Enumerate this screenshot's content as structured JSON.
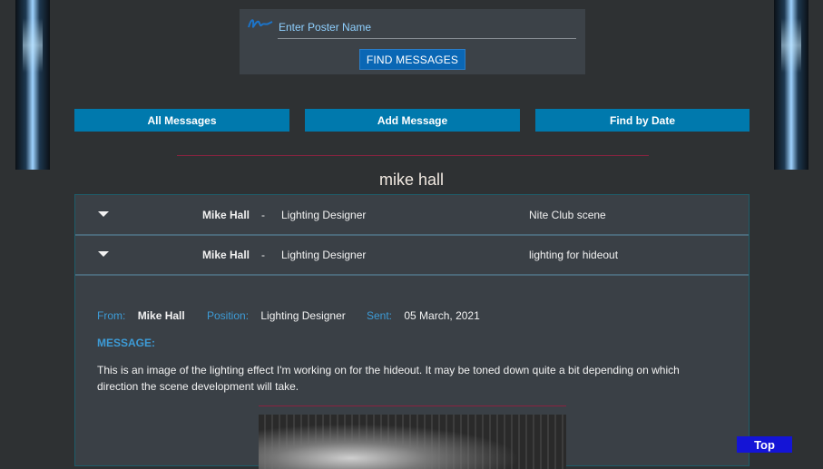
{
  "search": {
    "placeholder": "Enter Poster Name",
    "find_label": "FIND MESSAGES"
  },
  "nav": {
    "all_label": "All Messages",
    "add_label": "Add Message",
    "date_label": "Find by Date"
  },
  "page_title": "mike hall",
  "messages": [
    {
      "poster": "Mike Hall",
      "separator": "-",
      "position": "Lighting Designer",
      "subject": "Nite Club scene"
    },
    {
      "poster": "Mike Hall",
      "separator": "-",
      "position": "Lighting Designer",
      "subject": "lighting for hideout"
    }
  ],
  "detail": {
    "from_label": "From:",
    "from_value": "Mike Hall",
    "position_label": "Position:",
    "position_value": "Lighting Designer",
    "sent_label": "Sent:",
    "sent_value": "05 March, 2021",
    "message_label": "MESSAGE:",
    "message_body": "This is an image of the lighting effect I'm working on for the hideout. It may be toned down quite a bit depending on which direction the scene development will take."
  },
  "top_label": "Top",
  "colors": {
    "background": "#2e3133",
    "button_blue": "#0079ad",
    "accent_label": "#3d9bd6",
    "divider": "#8b2340",
    "top_button": "#1414d6"
  },
  "icons": {
    "signature": "signature-icon",
    "row_toggle": "caret-down-icon"
  }
}
